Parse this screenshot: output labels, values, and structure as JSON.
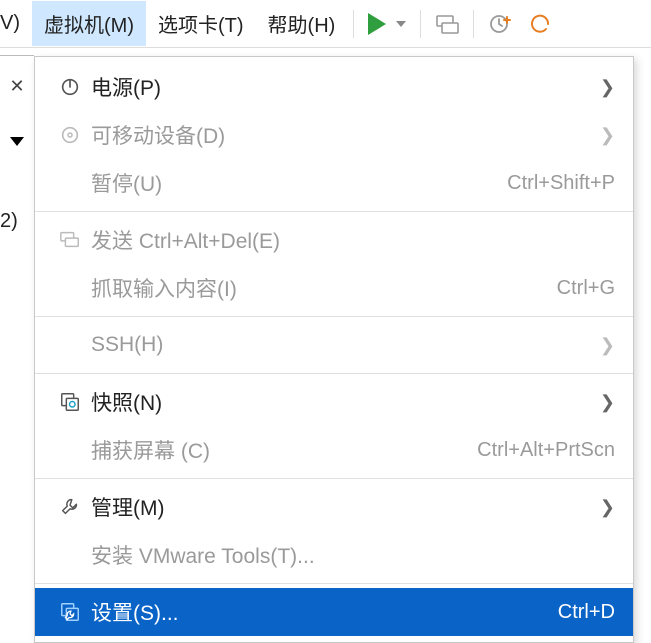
{
  "menubar": {
    "view_partial": "V)",
    "vm": "虚拟机(M)",
    "tabs": "选项卡(T)",
    "help": "帮助(H)"
  },
  "left": {
    "close": "✕",
    "num": "2)"
  },
  "menu": {
    "power": {
      "label": "电源(P)"
    },
    "removable": {
      "label": "可移动设备(D)"
    },
    "pause": {
      "label": "暂停(U)",
      "shortcut": "Ctrl+Shift+P"
    },
    "send_cad": {
      "label": "发送 Ctrl+Alt+Del(E)"
    },
    "grab_input": {
      "label": "抓取输入内容(I)",
      "shortcut": "Ctrl+G"
    },
    "ssh": {
      "label": "SSH(H)"
    },
    "snapshot": {
      "label": "快照(N)"
    },
    "capture": {
      "label": "捕获屏幕 (C)",
      "shortcut": "Ctrl+Alt+PrtScn"
    },
    "manage": {
      "label": "管理(M)"
    },
    "install_tools": {
      "label": "安装 VMware Tools(T)..."
    },
    "settings": {
      "label": "设置(S)...",
      "shortcut": "Ctrl+D"
    }
  }
}
